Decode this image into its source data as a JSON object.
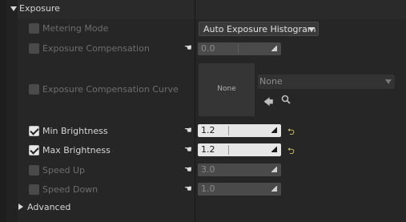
{
  "section": {
    "title": "Exposure",
    "advanced_label": "Advanced"
  },
  "properties": {
    "metering_mode": {
      "label": "Metering Mode",
      "value": "Auto Exposure Histogram"
    },
    "exposure_compensation": {
      "label": "Exposure Compensation",
      "value": "0.0"
    },
    "exposure_compensation_curve": {
      "label": "Exposure Compensation Curve",
      "thumbnail_text": "None",
      "asset_value": "None"
    },
    "min_brightness": {
      "label": "Min Brightness",
      "value": "1.2"
    },
    "max_brightness": {
      "label": "Max Brightness",
      "value": "1.2"
    },
    "speed_up": {
      "label": "Speed Up",
      "value": "3.0"
    },
    "speed_down": {
      "label": "Speed Down",
      "value": "1.0"
    }
  },
  "icons": {
    "expand": "triangle-down-icon",
    "collapse": "triangle-right-icon",
    "reset": "hand-pointer-icon",
    "revert": "revert-arrow-icon",
    "browse": "arrow-left-icon",
    "find": "search-icon"
  },
  "colors": {
    "background": "#262626",
    "revert_accent": "#e5d66a",
    "enabled_field": "#e6e6e6",
    "disabled_field": "#4a4a4a"
  }
}
